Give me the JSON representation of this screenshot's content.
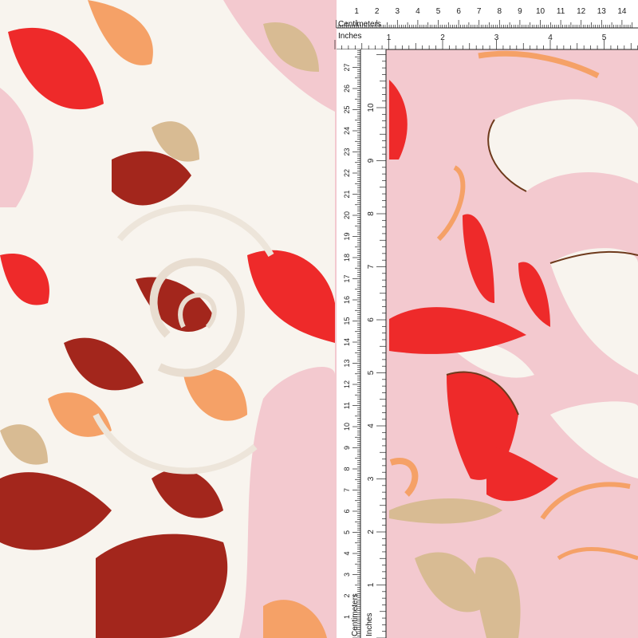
{
  "ruler": {
    "top_cm_label": "Centimeters",
    "top_in_label": "Inches",
    "left_cm_label": "Centimeters",
    "left_in_label": "Inches",
    "top_cm_numbers": [
      "1",
      "2",
      "3",
      "4",
      "5",
      "6",
      "7",
      "8",
      "9",
      "10",
      "11",
      "12",
      "13",
      "14"
    ],
    "top_in_numbers": [
      "1",
      "2",
      "3",
      "4",
      "5"
    ],
    "left_cm_numbers": [
      "27",
      "26",
      "25",
      "24",
      "23",
      "22",
      "21",
      "20",
      "19",
      "18",
      "17",
      "16",
      "15",
      "14",
      "13",
      "12",
      "11",
      "10",
      "9",
      "8",
      "7",
      "6",
      "5",
      "4",
      "3",
      "2",
      "1"
    ],
    "left_in_numbers": [
      "10",
      "9",
      "8",
      "7",
      "6",
      "5",
      "4",
      "3",
      "2",
      "1"
    ]
  },
  "colors": {
    "fabric_pink": "#f3c9cf",
    "fabric_white": "#f8f4ee",
    "accent_red": "#ee2a2a",
    "deep_red": "#a3261c",
    "orange": "#f5a167",
    "tan": "#d8bb93",
    "outline_brown": "#6e3a1c",
    "ruler_bg": "#ffffff"
  }
}
